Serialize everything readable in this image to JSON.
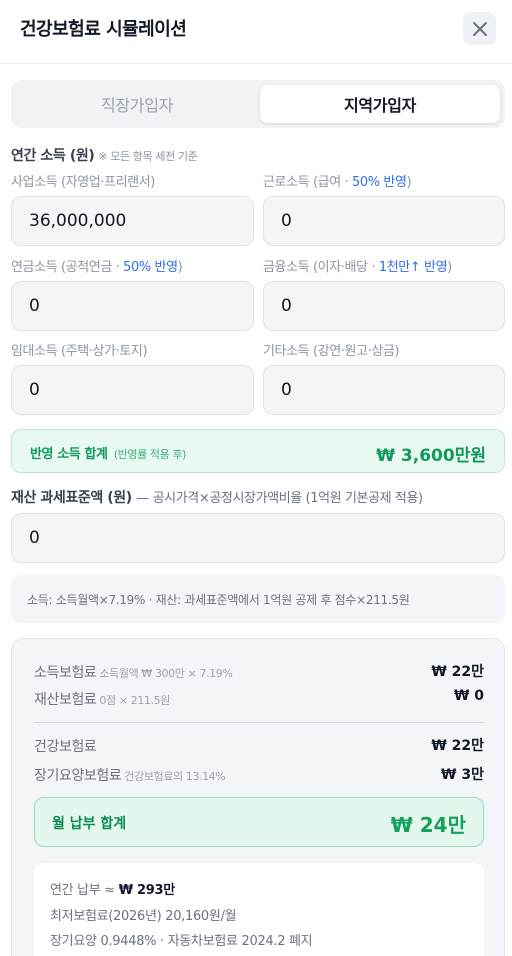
{
  "header": {
    "title": "건강보험료 시뮬레이션"
  },
  "tabs": [
    {
      "label": "직장가입자",
      "active": false
    },
    {
      "label": "지역가입자",
      "active": true
    }
  ],
  "income": {
    "title": "연간 소득 (원)",
    "note": "※ 모든 항목 세전 기준",
    "fields": {
      "business": {
        "label": "사업소득 (자영업·프리랜서)",
        "label_prefix": "",
        "label_highlight": "",
        "label_suffix": "",
        "value": "36,000,000"
      },
      "earned": {
        "label_prefix": "근로소득 (급여 · ",
        "label_highlight": "50% 반영",
        "label_suffix": ")",
        "value": "0"
      },
      "pension": {
        "label_prefix": "연금소득 (공적연금 · ",
        "label_highlight": "50% 반영",
        "label_suffix": ")",
        "value": "0"
      },
      "financial": {
        "label_prefix": "금융소득 (이자·배당 · ",
        "label_highlight": "1천만↑ 반영",
        "label_suffix": ")",
        "value": "0"
      },
      "rental": {
        "label": "임대소득 (주택·상가·토지)",
        "value": "0"
      },
      "other": {
        "label": "기타소득 (강연·원고·상금)",
        "value": "0"
      }
    },
    "total": {
      "label": "반영 소득 합계",
      "note": "(반영률 적용 후)",
      "value": "₩ 3,600만원"
    }
  },
  "property": {
    "title": "재산 과세표준액 (원)",
    "desc": "— 공시가격×공정시장가액비율 (1억원 기본공제 적용)",
    "value": "0"
  },
  "formula": "소득: 소득월액×7.19% · 재산: 과세표준액에서 1억원 공제 후 점수×211.5원",
  "result": {
    "income_premium": {
      "label": "소득보험료",
      "sub": "소득월액 ₩ 300만 × 7.19%",
      "value": "₩ 22만"
    },
    "property_premium": {
      "label": "재산보험료",
      "sub": "0점 × 211.5원",
      "value": "₩ 0"
    },
    "health_premium": {
      "label": "건강보험료",
      "value": "₩ 22만"
    },
    "ltc_premium": {
      "label": "장기요양보험료",
      "sub": "건강보험료의 13.14%",
      "value": "₩ 3만"
    },
    "monthly_total": {
      "label": "월 납부 합계",
      "value": "₩ 24만"
    },
    "info": {
      "annual_label": "연간 납부 ≈ ",
      "annual_value": "₩ 293만",
      "min_premium": "최저보험료(2026년) 20,160원/월",
      "ltc_note": "장기요양 0.9448% · 자동차보험료 2024.2 폐지"
    }
  },
  "colors": {
    "accent": "#2f6fed",
    "green": "#129a5d",
    "green_bg": "#e9f8f1"
  },
  "icons": {
    "close": "close-icon"
  }
}
